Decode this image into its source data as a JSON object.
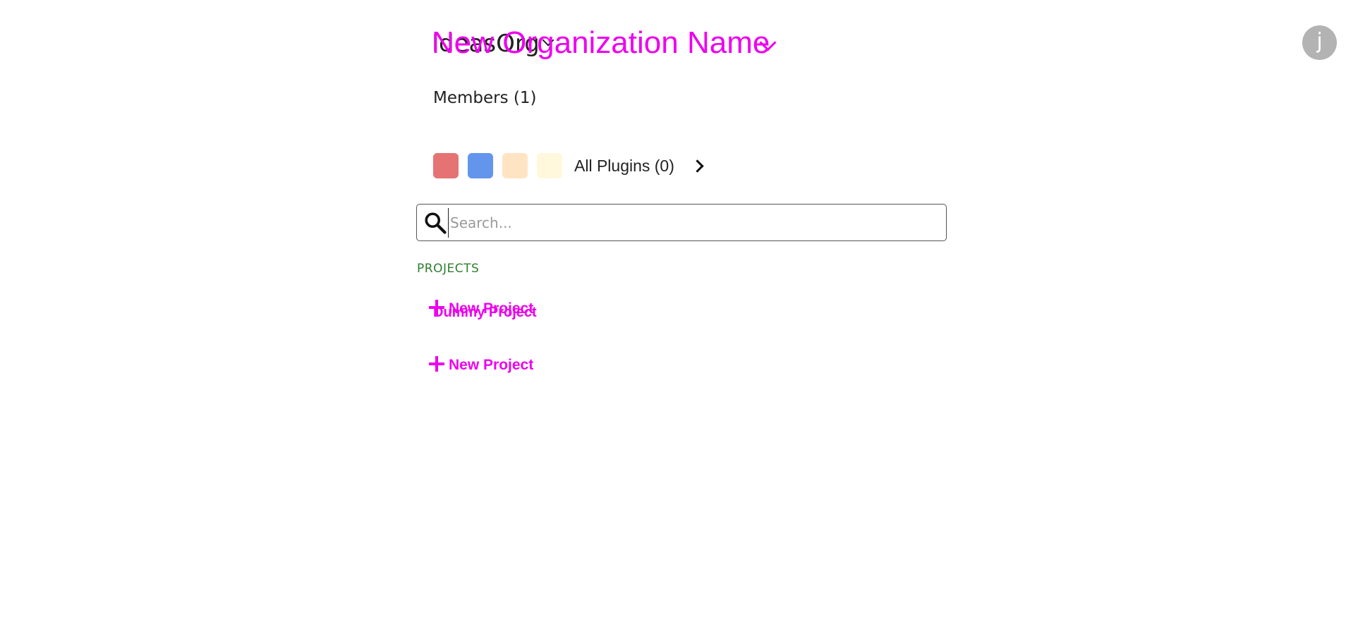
{
  "header": {
    "org_name_underlying": "IdeasOrg",
    "org_name_overlay": "New Organization Name",
    "overlay_color": "#ee00ee"
  },
  "avatar": {
    "initial": "j"
  },
  "members": {
    "label": "Members (1)"
  },
  "plugins": {
    "swatch_colors": [
      "#e57373",
      "#6495ed",
      "#ffe4c4",
      "#fff8dc"
    ],
    "label": "All Plugins (0)"
  },
  "search": {
    "placeholder": "Search...",
    "value": ""
  },
  "projects": {
    "heading": "PROJECTS",
    "heading_color": "#2f7d2f",
    "items": [
      {
        "name": "Dummy Project"
      }
    ],
    "new_project_label": "New Project"
  }
}
